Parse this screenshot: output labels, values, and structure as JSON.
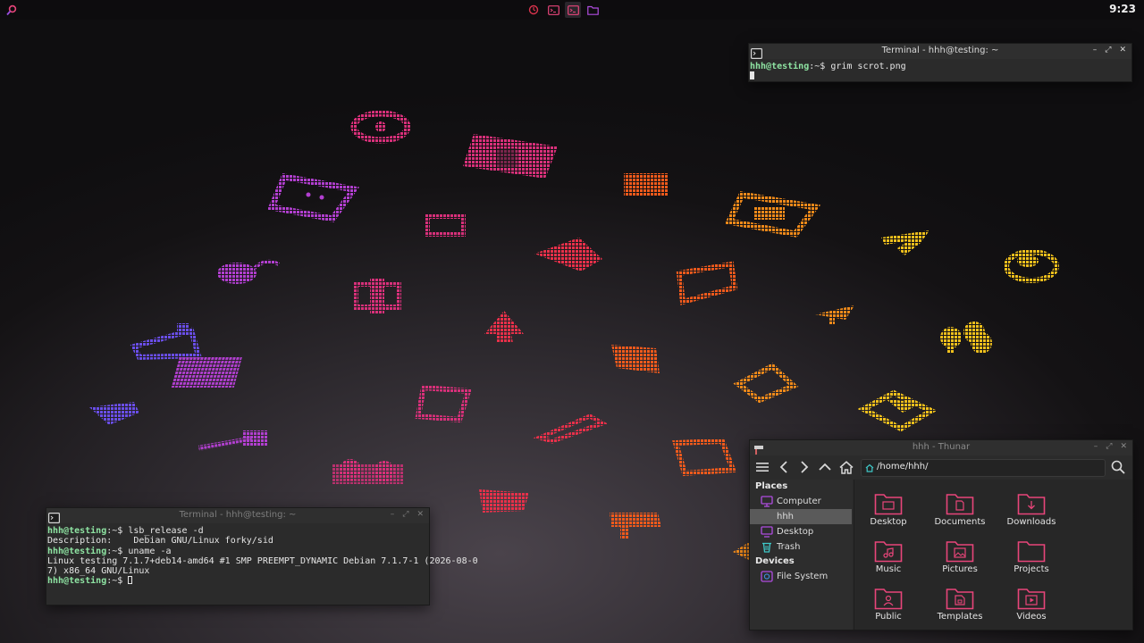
{
  "panel": {
    "clock": "9:23",
    "launcher_icon": "search-icon",
    "tasks": [
      {
        "icon": "timer-icon"
      },
      {
        "icon": "terminal-icon"
      },
      {
        "icon": "terminal-icon"
      },
      {
        "icon": "folder-icon"
      }
    ]
  },
  "colors": {
    "accent": "#e8457a",
    "folder": "#e8457a",
    "prompt": "#8ee3a2",
    "purple": "#9b4de0"
  },
  "terminal_top": {
    "title": "Terminal - hhh@testing: ~",
    "lines": [
      {
        "user": "hhh@testing",
        "path": ":~$ ",
        "cmd": "grim scrot.png"
      }
    ]
  },
  "terminal_bottom": {
    "title": "Terminal - hhh@testing: ~",
    "line1_user": "hhh@testing",
    "line1_path": ":~$ ",
    "line1_cmd": "lsb_release -d",
    "line2": "Description:\tDebian GNU/Linux forky/sid",
    "line3_user": "hhh@testing",
    "line3_path": ":~$ ",
    "line3_cmd": "uname -a",
    "line4": "Linux testing 7.1.7+deb14-amd64 #1 SMP PREEMPT_DYNAMIC Debian 7.1.7-1 (2026-08-0",
    "line5": "7) x86_64 GNU/Linux",
    "line6_user": "hhh@testing",
    "line6_path": ":~$ "
  },
  "thunar": {
    "title": "hhh - Thunar",
    "location": "/home/hhh/",
    "places_label": "Places",
    "devices_label": "Devices",
    "places": [
      {
        "label": "Computer",
        "icon": "computer-icon"
      },
      {
        "label": "hhh",
        "icon": "home-icon",
        "selected": true
      },
      {
        "label": "Desktop",
        "icon": "desktop-icon"
      },
      {
        "label": "Trash",
        "icon": "trash-icon"
      }
    ],
    "devices": [
      {
        "label": "File System",
        "icon": "drive-icon"
      }
    ],
    "folders": [
      {
        "label": "Desktop",
        "icon": "folder-desktop-icon"
      },
      {
        "label": "Documents",
        "icon": "folder-documents-icon"
      },
      {
        "label": "Downloads",
        "icon": "folder-downloads-icon"
      },
      {
        "label": "Music",
        "icon": "folder-music-icon"
      },
      {
        "label": "Pictures",
        "icon": "folder-pictures-icon"
      },
      {
        "label": "Projects",
        "icon": "folder-projects-icon"
      },
      {
        "label": "Public",
        "icon": "folder-public-icon"
      },
      {
        "label": "Templates",
        "icon": "folder-templates-icon"
      },
      {
        "label": "Videos",
        "icon": "folder-videos-icon"
      }
    ]
  }
}
